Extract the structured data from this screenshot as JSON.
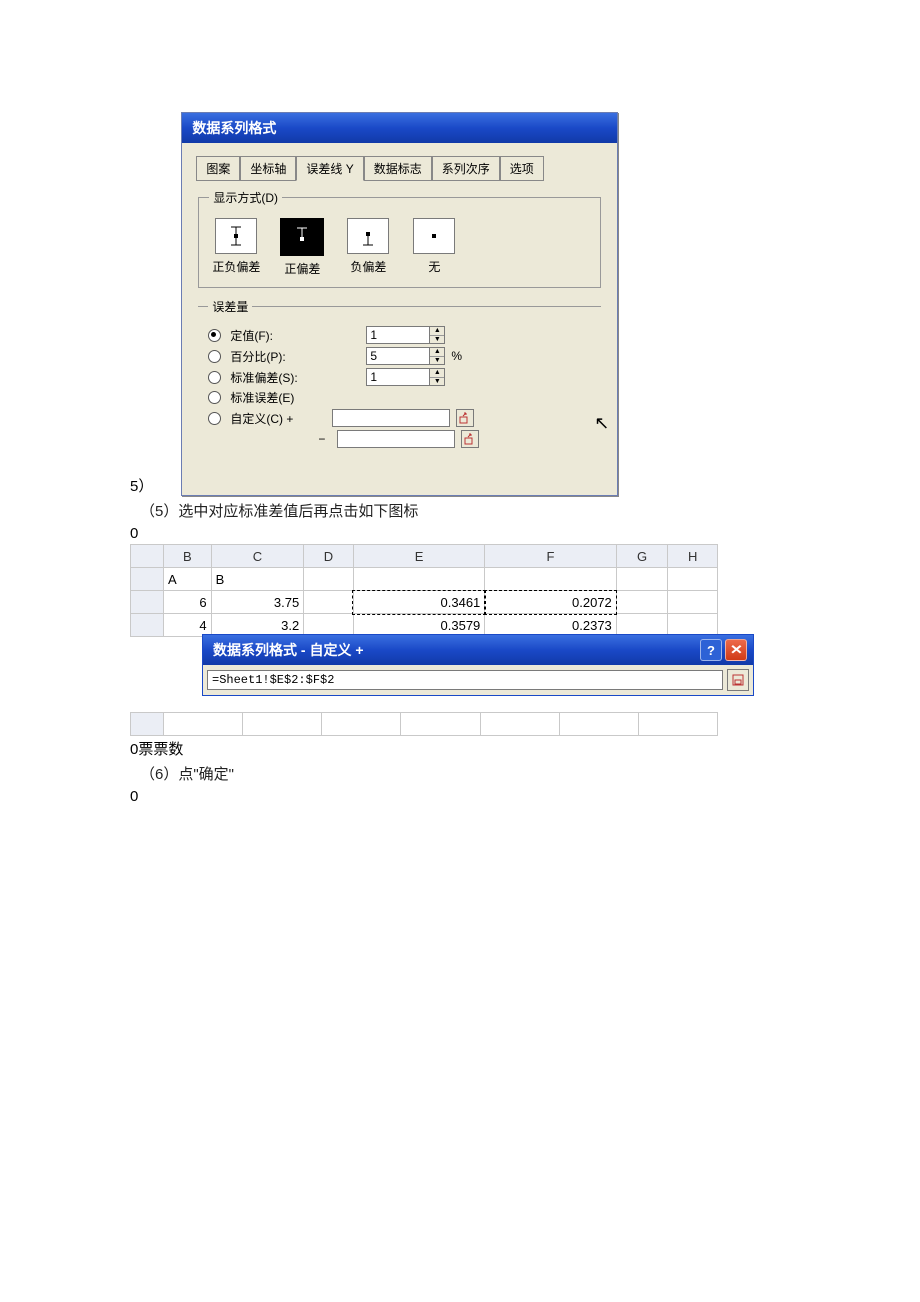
{
  "pre_dialog_marker": "5）",
  "dialog1": {
    "title": "数据系列格式",
    "tabs": [
      "图案",
      "坐标轴",
      "误差线 Y",
      "数据标志",
      "系列次序",
      "选项"
    ],
    "active_tab": 2,
    "display_group": {
      "legend": "显示方式(D)",
      "options": [
        "正负偏差",
        "正偏差",
        "负偏差",
        "无"
      ],
      "selected": 1
    },
    "error_group": {
      "legend": "误差量",
      "options": {
        "fixed": {
          "label": "定值(F):",
          "value": "1"
        },
        "percent": {
          "label": "百分比(P):",
          "value": "5",
          "suffix": "%"
        },
        "stddev": {
          "label": "标准偏差(S):",
          "value": "1"
        },
        "stderr": {
          "label": "标准误差(E)"
        },
        "custom": {
          "label": "自定义(C) +",
          "plus": "",
          "minus": "−"
        }
      },
      "selected": "fixed"
    }
  },
  "doc": {
    "line5": "（5）选中对应标准差值后再点击如下图标",
    "zero1": "0",
    "zero2": "0票票数",
    "line6": "（6）点\"确定\"",
    "zero3": "0"
  },
  "sheet": {
    "headers": [
      "",
      "B",
      "C",
      "D",
      "E",
      "F",
      "G",
      "H"
    ],
    "row_a": {
      "b": "A",
      "c": "B"
    },
    "row2": {
      "b": "6",
      "c": "3.75",
      "e": "0.3461",
      "f": "0.2072"
    },
    "row3": {
      "b": "4",
      "c": "3.2",
      "e": "0.3579",
      "f": "0.2373"
    }
  },
  "dialog2": {
    "title": "数据系列格式 - 自定义 +",
    "formula": "=Sheet1!$E$2:$F$2"
  }
}
